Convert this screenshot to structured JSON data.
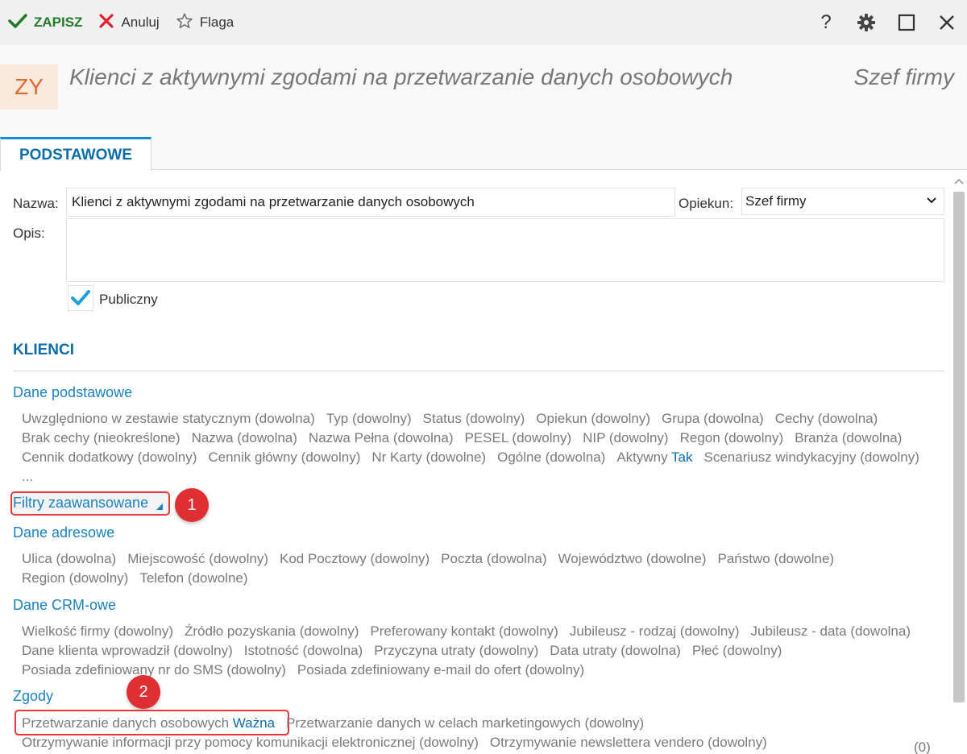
{
  "toolbar": {
    "save_label": "ZAPISZ",
    "cancel_label": "Anuluj",
    "flag_label": "Flaga",
    "help_label": "?"
  },
  "header": {
    "badge": "ZY",
    "title": "Klienci z aktywnymi zgodami na przetwarzanie danych osobowych",
    "owner": "Szef firmy"
  },
  "tabs": [
    {
      "label": "PODSTAWOWE",
      "active": true
    }
  ],
  "form": {
    "name_label": "Nazwa:",
    "name_value": "Klienci z aktywnymi zgodami na przetwarzanie danych osobowych",
    "owner_label": "Opiekun:",
    "owner_value": "Szef firmy",
    "desc_label": "Opis:",
    "desc_value": "",
    "public_label": "Publiczny",
    "public_checked": true
  },
  "section": {
    "title": "KLIENCI",
    "basic": {
      "title": "Dane podstawowe",
      "filters": [
        {
          "name": "Uwzględniono w zestawie statycznym",
          "value": "(dowolna)"
        },
        {
          "name": "Typ",
          "value": "(dowolny)"
        },
        {
          "name": "Status",
          "value": "(dowolny)"
        },
        {
          "name": "Opiekun",
          "value": "(dowolny)"
        },
        {
          "name": "Grupa",
          "value": "(dowolna)"
        },
        {
          "name": "Cechy",
          "value": "(dowolna)"
        },
        {
          "name": "Brak cechy",
          "value": "(nieokreślone)"
        },
        {
          "name": "Nazwa",
          "value": "(dowolna)"
        },
        {
          "name": "Nazwa Pełna",
          "value": "(dowolna)"
        },
        {
          "name": "PESEL",
          "value": "(dowolny)"
        },
        {
          "name": "NIP",
          "value": "(dowolny)"
        },
        {
          "name": "Regon",
          "value": "(dowolny)"
        },
        {
          "name": "Branża",
          "value": "(dowolna)"
        },
        {
          "name": "Cennik dodatkowy",
          "value": "(dowolny)"
        },
        {
          "name": "Cennik główny",
          "value": "(dowolny)"
        },
        {
          "name": "Nr Karty",
          "value": "(dowolne)"
        },
        {
          "name": "Ogólne",
          "value": "(dowolna)"
        },
        {
          "name": "Aktywny",
          "value": "Tak",
          "active": true
        },
        {
          "name": "Scenariusz windykacyjny",
          "value": "(dowolny)"
        },
        {
          "name": "...",
          "value": ""
        }
      ]
    },
    "advanced": {
      "title": "Filtry zaawansowane",
      "callout": "1"
    },
    "address": {
      "title": "Dane adresowe",
      "filters": [
        {
          "name": "Ulica",
          "value": "(dowolna)"
        },
        {
          "name": "Miejscowość",
          "value": "(dowolny)"
        },
        {
          "name": "Kod Pocztowy",
          "value": "(dowolny)"
        },
        {
          "name": "Poczta",
          "value": "(dowolna)"
        },
        {
          "name": "Województwo",
          "value": "(dowolne)"
        },
        {
          "name": "Państwo",
          "value": "(dowolne)"
        },
        {
          "name": "Region",
          "value": "(dowolny)"
        },
        {
          "name": "Telefon",
          "value": "(dowolne)"
        }
      ]
    },
    "crm": {
      "title": "Dane CRM-owe",
      "filters": [
        {
          "name": "Wielkość firmy",
          "value": "(dowolny)"
        },
        {
          "name": "Źródło pozyskania",
          "value": "(dowolny)"
        },
        {
          "name": "Preferowany kontakt",
          "value": "(dowolny)"
        },
        {
          "name": "Jubileusz - rodzaj",
          "value": "(dowolny)"
        },
        {
          "name": "Jubileusz - data",
          "value": "(dowolna)"
        },
        {
          "name": "Dane klienta wprowadził",
          "value": "(dowolny)"
        },
        {
          "name": "Istotność",
          "value": "(dowolna)"
        },
        {
          "name": "Przyczyna utraty",
          "value": "(dowolny)"
        },
        {
          "name": "Data utraty",
          "value": "(dowolna)"
        },
        {
          "name": "Płeć",
          "value": "(dowolny)"
        },
        {
          "name": "Posiada zdefiniowany nr do SMS",
          "value": "(dowolny)"
        },
        {
          "name": "Posiada zdefiniowany e-mail do ofert",
          "value": "(dowolny)"
        }
      ]
    },
    "consents": {
      "title": "Zgody",
      "callout": "2",
      "filters": [
        {
          "name": "Przetwarzanie danych osobowych",
          "value": "Ważna",
          "active": true
        },
        {
          "name": "Przetwarzanie danych w celach marketingowych",
          "value": "(dowolny)"
        },
        {
          "name": "Otrzymywanie informacji przy pomocy komunikacji elektronicznej",
          "value": "(dowolny)"
        },
        {
          "name": "Otrzymywanie newslettera vendero",
          "value": "(dowolny)"
        }
      ]
    },
    "count": "(0)"
  },
  "colors": {
    "accent": "#0b6ea8",
    "link": "#1b82bf",
    "save": "#217a2a",
    "cancel": "#e0202a",
    "callout": "#e02f33",
    "badge_bg": "#fbe8dc",
    "badge_fg": "#e06a2a"
  }
}
